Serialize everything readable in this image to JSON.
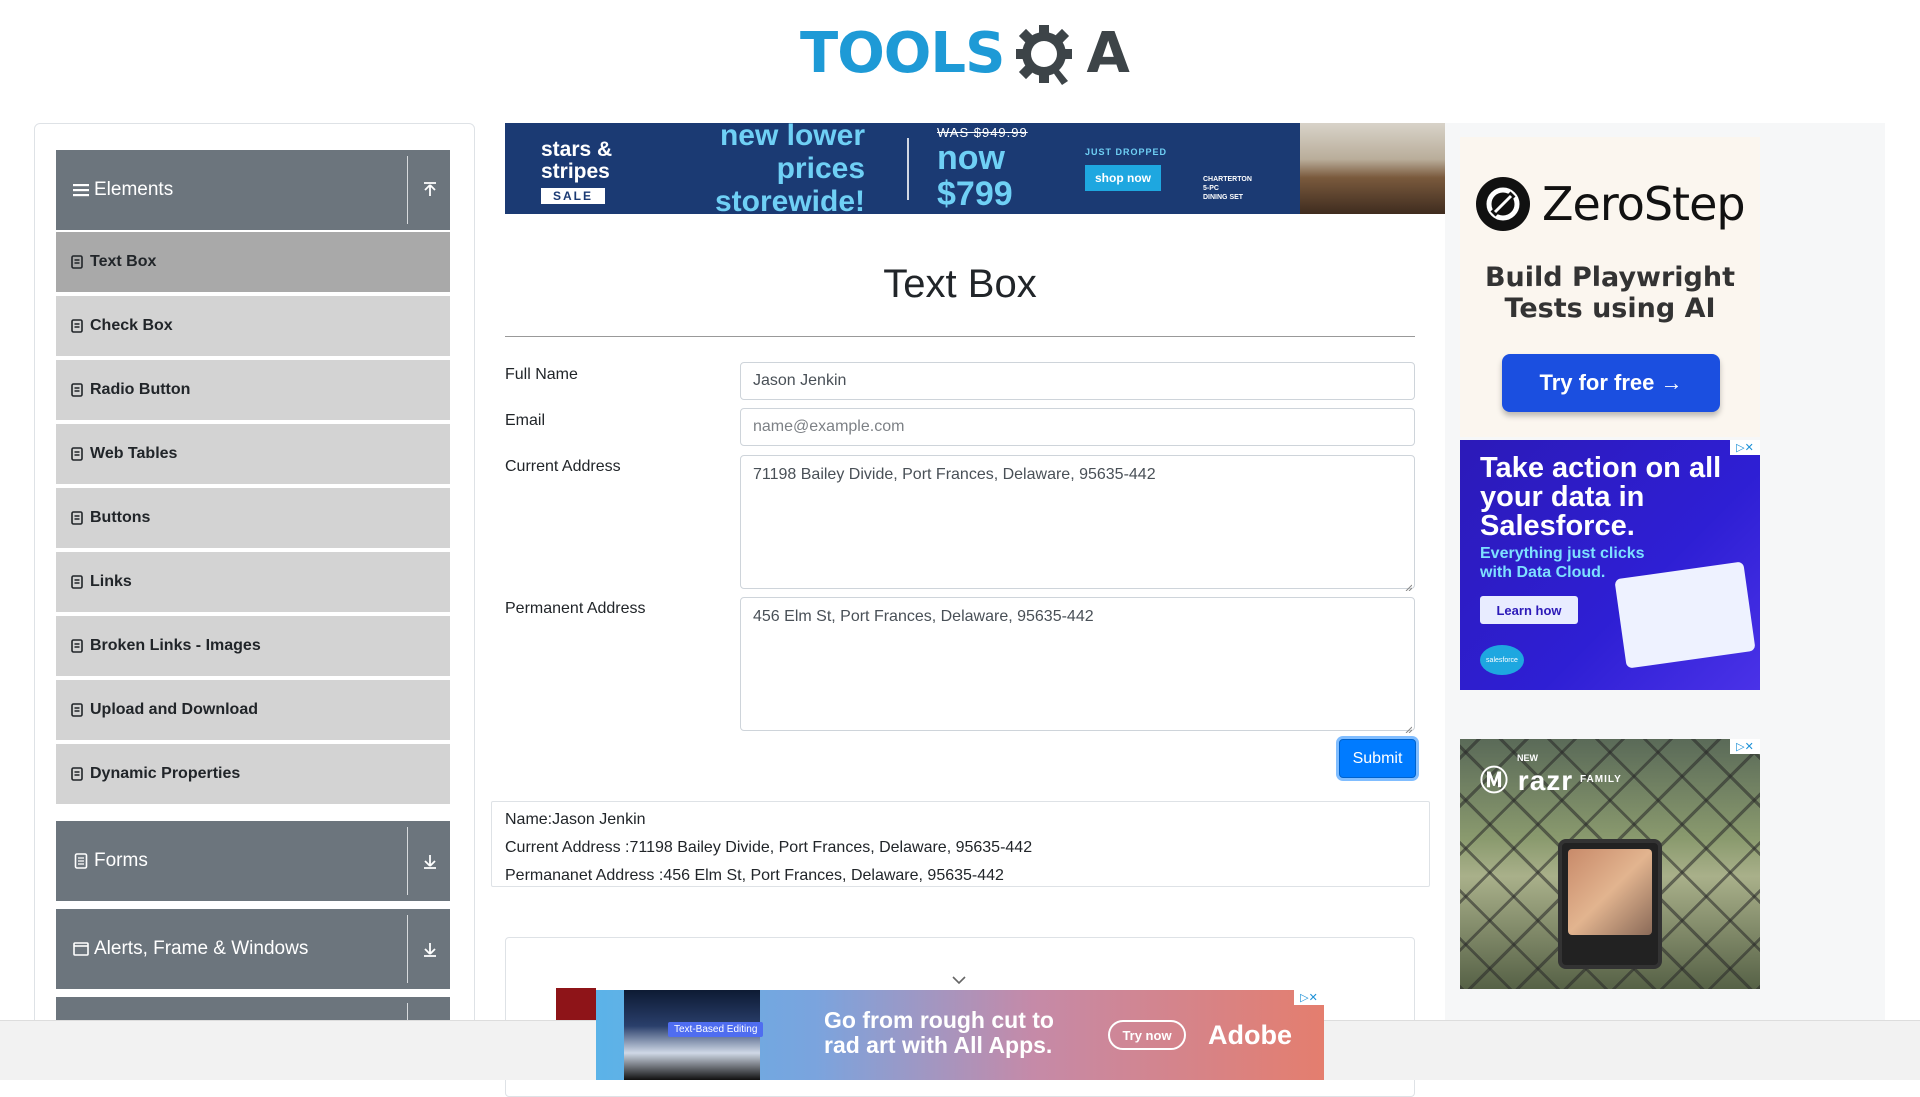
{
  "header": {
    "logo_text_left": "TOOLS",
    "logo_text_right": "A"
  },
  "sidebar": {
    "groups": [
      {
        "title": "Elements",
        "expanded": true
      },
      {
        "title": "Forms",
        "expanded": false
      },
      {
        "title": "Alerts, Frame & Windows",
        "expanded": false
      }
    ],
    "items": [
      {
        "label": "Text Box",
        "active": true
      },
      {
        "label": "Check Box"
      },
      {
        "label": "Radio Button"
      },
      {
        "label": "Web Tables"
      },
      {
        "label": "Buttons"
      },
      {
        "label": "Links"
      },
      {
        "label": "Broken Links - Images"
      },
      {
        "label": "Upload and Download"
      },
      {
        "label": "Dynamic Properties"
      }
    ]
  },
  "top_ad": {
    "stars_line1": "stars &",
    "stars_line2": "stripes",
    "sale": "SALE",
    "headline_line1": "new lower prices",
    "headline_line2": "storewide!",
    "was": "WAS $949.99",
    "now": "now $799",
    "just_dropped": "JUST DROPPED",
    "shop_now": "shop now",
    "product_line1": "CHARTERTON",
    "product_line2": "5-PC",
    "product_line3": "DINING SET"
  },
  "main": {
    "title": "Text Box",
    "form": {
      "full_name_label": "Full Name",
      "full_name_value": "Jason Jenkin",
      "email_label": "Email",
      "email_placeholder": "name@example.com",
      "current_address_label": "Current Address",
      "current_address_value": "71198 Bailey Divide, Port Frances, Delaware, 95635-442",
      "permanent_address_label": "Permanent Address",
      "permanent_address_value": "456 Elm St, Port Frances, Delaware, 95635-442",
      "submit_label": "Submit"
    },
    "output": {
      "name": "Name:Jason Jenkin",
      "current_address": "Current Address :71198 Bailey Divide, Port Frances, Delaware, 95635-442",
      "permanent_address": "Permananet Address :456 Elm St, Port Frances, Delaware, 95635-442"
    }
  },
  "right_ads": {
    "zerostep": {
      "brand": "ZeroStep",
      "tagline_line1": "Build Playwright",
      "tagline_line2": "Tests using AI",
      "cta": "Try for free →"
    },
    "salesforce": {
      "headline": "Take action on all your data in Salesforce.",
      "subline": "Everything just clicks with Data Cloud.",
      "cta": "Learn how",
      "logo": "salesforce"
    },
    "razr": {
      "new": "NEW",
      "brand": "razr",
      "family": "FAMILY"
    }
  },
  "bottom_ad": {
    "tag": "Text-Based Editing",
    "headline": "Go from rough cut to rad art with All Apps.",
    "cta": "Try now",
    "brand": "Adobe"
  },
  "colors": {
    "group_header_bg": "#6c757d",
    "menu_item_bg": "#d3d3d3",
    "menu_item_active_bg": "#a9a9a9",
    "primary": "#007bff",
    "logo_blue": "#1e9ad6"
  }
}
